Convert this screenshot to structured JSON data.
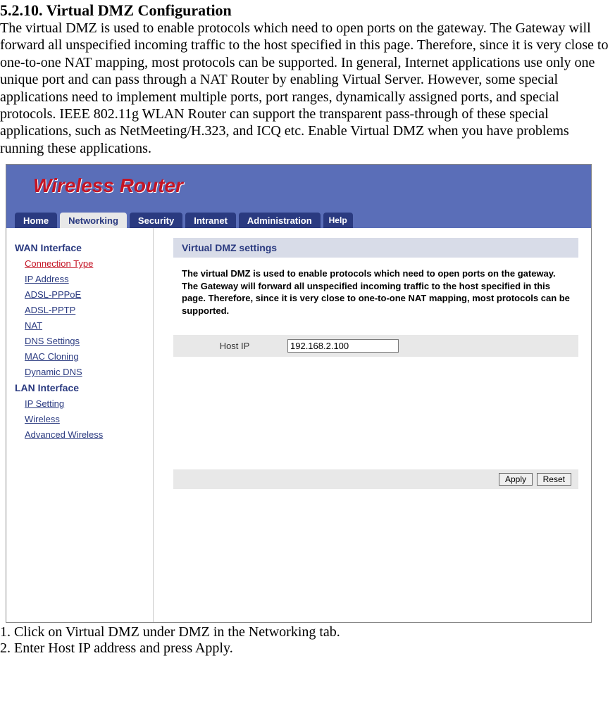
{
  "doc": {
    "section_title": "5.2.10. Virtual DMZ Configuration",
    "paragraph": "The virtual DMZ is used to enable protocols which need to open ports on the gateway. The Gateway will forward all unspecified incoming traffic to the host specified in this page. Therefore, since it is very close to one-to-one NAT mapping, most protocols can be supported. In general, Internet applications use only one unique port and can pass through a NAT Router by enabling Virtual Server. However, some special applications need to implement multiple ports, port ranges, dynamically assigned ports, and special protocols. IEEE 802.11g WLAN Router can support the transparent pass-through of these special applications, such as NetMeeting/H.323, and ICQ etc. Enable Virtual DMZ when you have problems running these applications.",
    "step1": "1. Click on Virtual DMZ under DMZ in the Networking tab.",
    "step2": "2. Enter Host IP address and press Apply."
  },
  "router": {
    "logo": "Wireless Router",
    "tabs": {
      "home": "Home",
      "networking": "Networking",
      "security": "Security",
      "intranet": "Intranet",
      "administration": "Administration",
      "help": "Help"
    },
    "sidebar": {
      "wan_heading": "WAN Interface",
      "wan": {
        "connection_type": "Connection Type",
        "ip_address": "IP Address",
        "adsl_pppoe": "ADSL-PPPoE",
        "adsl_pptp": "ADSL-PPTP",
        "nat": "NAT",
        "dns_settings": "DNS Settings",
        "mac_cloning": "MAC Cloning",
        "dynamic_dns": "Dynamic DNS"
      },
      "lan_heading": "LAN Interface",
      "lan": {
        "ip_setting": "IP Setting",
        "wireless": "Wireless",
        "advanced_wireless": "Advanced Wireless"
      }
    },
    "content": {
      "title": "Virtual DMZ settings",
      "desc": "The virtual DMZ is used to enable protocols which need to open ports on the gateway. The Gateway will forward all unspecified incoming traffic to the host specified in this page. Therefore, since it is very close to one-to-one NAT mapping, most protocols can be supported.",
      "host_ip_label": "Host IP",
      "host_ip_value": "192.168.2.100",
      "apply": "Apply",
      "reset": "Reset"
    }
  }
}
